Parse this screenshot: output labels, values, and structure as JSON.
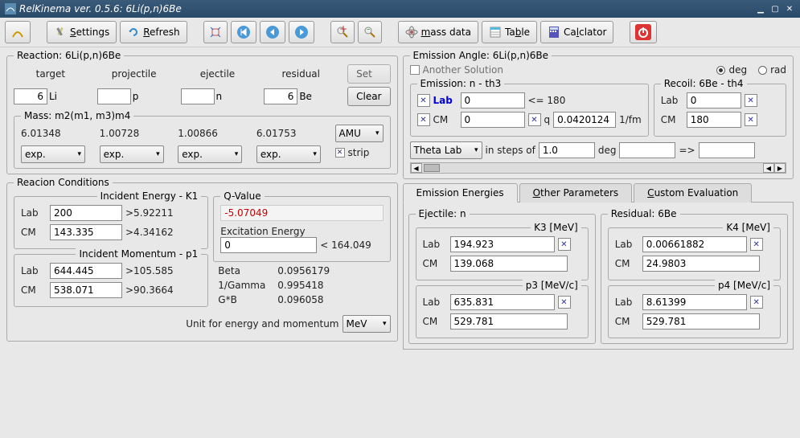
{
  "window": {
    "title": "RelKinema ver. 0.5.6: 6Li(p,n)6Be"
  },
  "toolbar": {
    "settings": "Settings",
    "refresh": "Refresh",
    "mass_data": "mass data",
    "table": "Table",
    "calc": "Calclator"
  },
  "reaction": {
    "legend": "Reaction: 6Li(p,n)6Be",
    "hdr": {
      "target": "target",
      "projectile": "projectile",
      "ejectile": "ejectile",
      "residual": "residual"
    },
    "set": "Set",
    "clear": "Clear",
    "target_a": "6",
    "target_s": "Li",
    "proj_a": "",
    "proj_s": "p",
    "ejec_a": "",
    "ejec_s": "n",
    "resid_a": "6",
    "resid_s": "Be"
  },
  "mass": {
    "legend": "Mass: m2(m1, m3)m4",
    "m": [
      "6.01348",
      "1.00728",
      "1.00866",
      "6.01753"
    ],
    "src": [
      "exp.",
      "exp.",
      "exp.",
      "exp."
    ],
    "unit": "AMU",
    "strip": "strip"
  },
  "cond": {
    "legend": "Reacion Conditions",
    "ie_legend": "Incident Energy - K1",
    "ie_lab": "200",
    "ie_lab_gt": ">5.92211",
    "ie_cm": "143.335",
    "ie_cm_gt": ">4.34162",
    "im_legend": "Incident Momentum - p1",
    "im_lab": "644.445",
    "im_lab_gt": ">105.585",
    "im_cm": "538.071",
    "im_cm_gt": ">90.3664",
    "qv_legend": "Q-Value",
    "qv": "-5.07049",
    "ex_legend": "Excitation Energy",
    "ex": "0",
    "ex_lt": "< 164.049",
    "beta_l": "Beta",
    "beta": "0.0956179",
    "ig_l": "1/Gamma",
    "ig": "0.995418",
    "gb_l": "G*B",
    "gb": "0.096058",
    "unit_l": "Unit for energy and momentum",
    "unit": "MeV",
    "lab": "Lab",
    "cm": "CM"
  },
  "emiss": {
    "legend": "Emission Angle: 6Li(p,n)6Be",
    "another": "Another Solution",
    "deg": "deg",
    "rad": "rad",
    "em_legend": "Emission: n - th3",
    "lab_l": "Lab",
    "lab_v": "0",
    "lab_lt": "<= 180",
    "cm_l": "CM",
    "cm_v": "0",
    "q_l": "q",
    "q_v": "0.0420124",
    "q_u": "1/fm",
    "rec_legend": "Recoil: 6Be - th4",
    "rec_lab": "0",
    "rec_cm": "180",
    "theta": "Theta Lab",
    "steps_l": "in steps of",
    "steps_v": "1.0",
    "steps_u": "deg",
    "arrow": "=>"
  },
  "tabs": {
    "t1": "Emission Energies",
    "t2": "Other Parameters",
    "t3": "Custom Evaluation"
  },
  "ej": {
    "legend": "Ejectile: n",
    "k_legend": "K3 [MeV]",
    "k_lab": "194.923",
    "k_cm": "139.068",
    "p_legend": "p3 [MeV/c]",
    "p_lab": "635.831",
    "p_cm": "529.781"
  },
  "res": {
    "legend": "Residual: 6Be",
    "k_legend": "K4 [MeV]",
    "k_lab": "0.00661882",
    "k_cm": "24.9803",
    "p_legend": "p4 [MeV/c]",
    "p_lab": "8.61399",
    "p_cm": "529.781"
  },
  "c": {
    "lab": "Lab",
    "cm": "CM"
  }
}
